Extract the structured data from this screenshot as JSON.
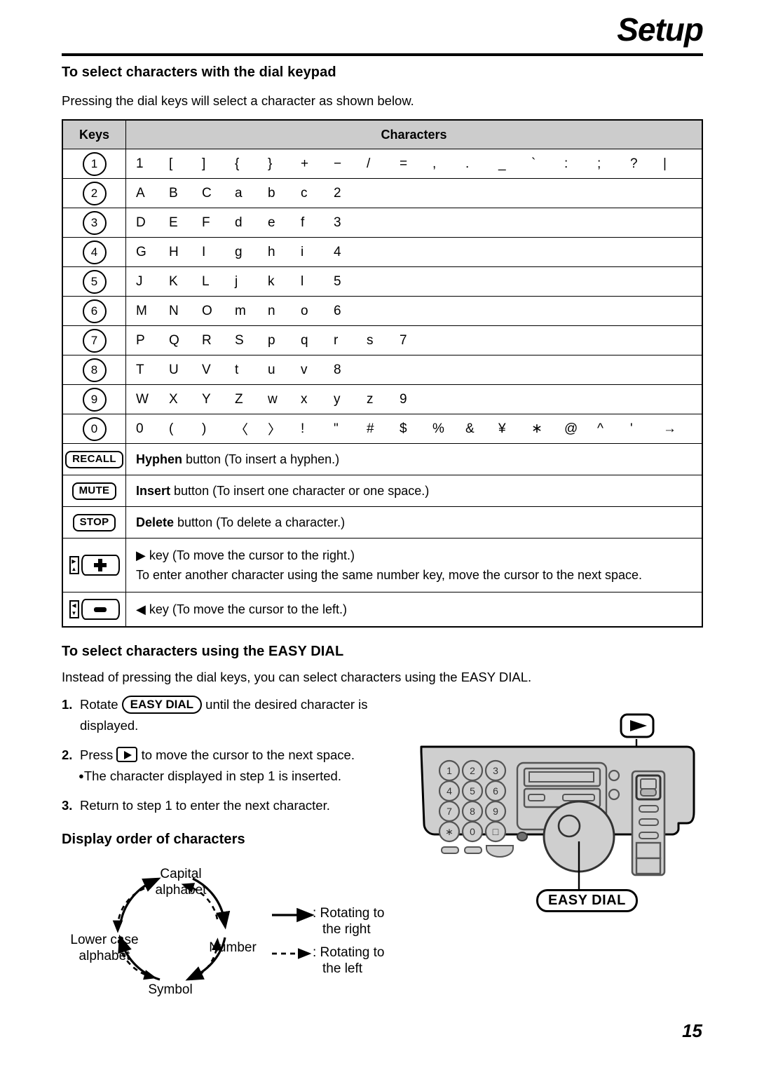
{
  "header": {
    "title": "Setup"
  },
  "section1": {
    "heading": "To select characters with the dial keypad",
    "intro": "Pressing the dial keys will select a character as shown below."
  },
  "table": {
    "columns": {
      "keys": "Keys",
      "characters": "Characters"
    },
    "rows": [
      {
        "key": "1",
        "key_type": "circle",
        "chars": [
          "1",
          "[",
          "]",
          "{",
          "}",
          "+",
          "−",
          "/",
          "=",
          ",",
          ".",
          "_",
          "`",
          ":",
          ";",
          "?",
          "|"
        ]
      },
      {
        "key": "2",
        "key_type": "circle",
        "chars": [
          "A",
          "B",
          "C",
          "a",
          "b",
          "c",
          "2"
        ]
      },
      {
        "key": "3",
        "key_type": "circle",
        "chars": [
          "D",
          "E",
          "F",
          "d",
          "e",
          "f",
          "3"
        ]
      },
      {
        "key": "4",
        "key_type": "circle",
        "chars": [
          "G",
          "H",
          "I",
          "g",
          "h",
          "i",
          "4"
        ]
      },
      {
        "key": "5",
        "key_type": "circle",
        "chars": [
          "J",
          "K",
          "L",
          "j",
          "k",
          "l",
          "5"
        ]
      },
      {
        "key": "6",
        "key_type": "circle",
        "chars": [
          "M",
          "N",
          "O",
          "m",
          "n",
          "o",
          "6"
        ]
      },
      {
        "key": "7",
        "key_type": "circle",
        "chars": [
          "P",
          "Q",
          "R",
          "S",
          "p",
          "q",
          "r",
          "s",
          "7"
        ]
      },
      {
        "key": "8",
        "key_type": "circle",
        "chars": [
          "T",
          "U",
          "V",
          "t",
          "u",
          "v",
          "8"
        ]
      },
      {
        "key": "9",
        "key_type": "circle",
        "chars": [
          "W",
          "X",
          "Y",
          "Z",
          "w",
          "x",
          "y",
          "z",
          "9"
        ]
      },
      {
        "key": "0",
        "key_type": "circle",
        "chars": [
          "0",
          "(",
          ")",
          "〈",
          "〉",
          "!",
          "\"",
          "#",
          "$",
          "%",
          "&",
          "¥",
          "∗",
          "@",
          "^",
          "'",
          "→"
        ]
      }
    ],
    "button_rows": [
      {
        "key": "RECALL",
        "key_type": "button",
        "bold": "Hyphen",
        "rest": " button (To insert a hyphen.)"
      },
      {
        "key": "MUTE",
        "key_type": "button",
        "bold": "Insert",
        "rest": " button (To insert one character or one space.)"
      },
      {
        "key": "STOP",
        "key_type": "button",
        "bold": "Delete",
        "rest": " button (To delete a character.)"
      }
    ],
    "cursor_rows": [
      {
        "key_icon": "volume-up-key",
        "line1": "▶ key (To move the cursor to the right.)",
        "line2": "To enter another character using the same number key, move the cursor to the next space."
      },
      {
        "key_icon": "volume-down-key",
        "line1": "◀ key (To move the cursor to the left.)",
        "line2": ""
      }
    ]
  },
  "section2": {
    "heading": "To select characters using the EASY DIAL",
    "intro": "Instead of pressing the dial keys, you can select characters using the EASY DIAL.",
    "steps": [
      {
        "n": "1.",
        "before": "Rotate ",
        "pill": "EASY DIAL",
        "after": " until the desired character is",
        "line2": "displayed."
      },
      {
        "n": "2.",
        "before": "Press ",
        "pill": "",
        "after": " to move the cursor to the next space.",
        "line2": ""
      },
      {
        "n": "3.",
        "before": "Return to step 1 to enter the next character.",
        "pill": "",
        "after": "",
        "line2": ""
      }
    ],
    "step2_note": "The character displayed in step 1 is inserted."
  },
  "section3": {
    "heading": "Display order of characters",
    "nodes": {
      "capital": "Capital\nalphabet",
      "capital_l1": "Capital",
      "capital_l2": "alphabet",
      "number": "Number",
      "symbol": "Symbol",
      "lower_l1": "Lower case",
      "lower_l2": "alphabet"
    },
    "legend": {
      "solid_l1": ": Rotating to",
      "solid_l2": "the right",
      "dashed_l1": ": Rotating to",
      "dashed_l2": "the left"
    }
  },
  "device": {
    "keypad": [
      "1",
      "2",
      "3",
      "4",
      "5",
      "6",
      "7",
      "8",
      "9",
      "∗",
      "0",
      "□"
    ],
    "callout_easy_dial": "EASY DIAL",
    "callout_arrow_icon": "right-arrow-key"
  },
  "footer": {
    "page_number": "15"
  },
  "colors": {
    "header_gray": "#cccccc",
    "device_body": "#cfcfcf",
    "ink": "#000000"
  }
}
